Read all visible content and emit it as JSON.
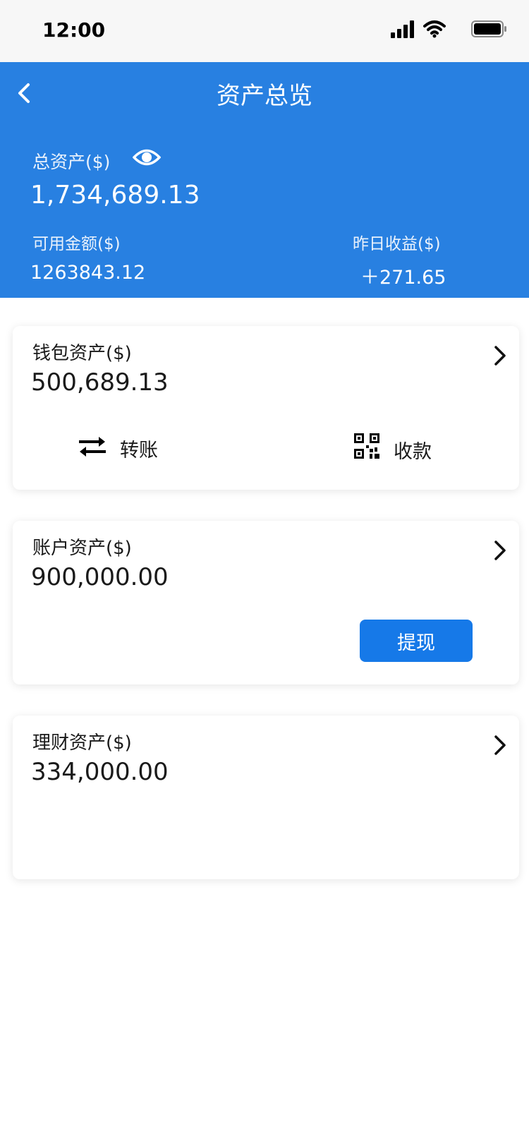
{
  "status_bar": {
    "time": "12:00"
  },
  "header": {
    "title": "资产总览"
  },
  "summary": {
    "total_label": "总资产($)",
    "total_value": "1,734,689.13",
    "available_label": "可用金额($)",
    "available_value": "1263843.12",
    "yesterday_label": "昨日收益($)",
    "yesterday_value": "＋271.65"
  },
  "wallet": {
    "label": "钱包资产($)",
    "value": "500,689.13",
    "transfer_label": "转账",
    "receive_label": "收款"
  },
  "account": {
    "label": "账户资产($)",
    "value": "900,000.00",
    "withdraw_label": "提现"
  },
  "finance": {
    "label": "理财资产($)",
    "value": "334,000.00"
  },
  "colors": {
    "primary": "#2880e1",
    "button": "#1679e8",
    "background": "#ffffff",
    "text": "#1a1a1a"
  },
  "icons": [
    "back-icon",
    "eye-icon",
    "chevron-right-icon",
    "transfer-icon",
    "qr-code-icon",
    "signal-icon",
    "wifi-icon",
    "battery-icon"
  ]
}
